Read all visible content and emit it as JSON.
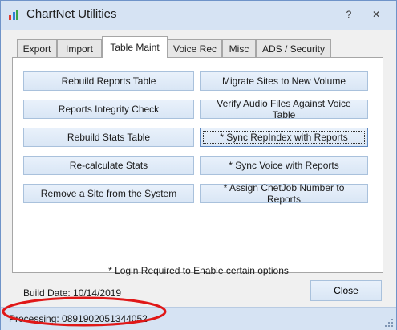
{
  "window": {
    "title": "ChartNet Utilities",
    "icon": "chartnet-app-icon",
    "controls": {
      "help": "?",
      "close": "✕"
    }
  },
  "tabs": [
    {
      "label": "Export",
      "active": false
    },
    {
      "label": "Import",
      "active": false
    },
    {
      "label": "Table Maint",
      "active": true
    },
    {
      "label": "Voice Rec",
      "active": false
    },
    {
      "label": "Misc",
      "active": false
    },
    {
      "label": "ADS / Security",
      "active": false
    }
  ],
  "table_maint": {
    "left_buttons": [
      "Rebuild Reports Table",
      "Reports Integrity Check",
      "Rebuild Stats Table",
      "Re-calculate Stats",
      "Remove a Site from the System"
    ],
    "right_buttons": [
      "Migrate Sites to New Volume",
      "Verify Audio Files Against Voice Table",
      "* Sync RepIndex with Reports",
      "* Sync Voice with Reports",
      "* Assign CnetJob Number to Reports"
    ],
    "focused_button": "* Sync RepIndex with Reports"
  },
  "footer": {
    "note": "* Login Required to Enable certain options",
    "build_date": "Build Date: 10/14/2019",
    "close_label": "Close"
  },
  "statusbar": {
    "text": "Processing: 0891902051344052"
  },
  "colors": {
    "title_bg": "#d6e3f3",
    "button_border": "#a9c1dc",
    "annotation_red": "#e01818"
  }
}
